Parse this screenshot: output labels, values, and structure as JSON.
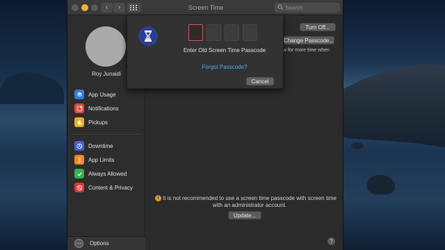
{
  "window": {
    "title": "Screen Time"
  },
  "search": {
    "placeholder": "Search"
  },
  "sidebar": {
    "user_name": "Roy Junaidi",
    "group1": [
      {
        "label": "App Usage",
        "icon": "layers-icon",
        "color": "#2f7de0"
      },
      {
        "label": "Notifications",
        "icon": "notifications-icon",
        "color": "#e04a3a"
      },
      {
        "label": "Pickups",
        "icon": "pickups-icon",
        "color": "#e8b21c"
      }
    ],
    "group2": [
      {
        "label": "Downtime",
        "icon": "downtime-icon",
        "color": "#4a5fd0"
      },
      {
        "label": "App Limits",
        "icon": "app-limits-icon",
        "color": "#f08a24"
      },
      {
        "label": "Always Allowed",
        "icon": "checkmark-icon",
        "color": "#37b24d"
      },
      {
        "label": "Content & Privacy",
        "icon": "restriction-icon",
        "color": "#e03535"
      }
    ],
    "options_label": "Options"
  },
  "main": {
    "turn_off_label": "Turn Off...",
    "change_passcode_label": "Change Passcode...",
    "more_time_text": "w for more time when",
    "warning_text": "It is not recommended to use a screen time passcode with screen time with an administrator account.",
    "update_label": "Update...",
    "help_label": "?"
  },
  "sheet": {
    "title": "Enter Old Screen Time Passcode",
    "forgot_label": "Forgot Passcode?",
    "cancel_label": "Cancel"
  },
  "colors": {
    "accent_link": "#5ba5f5",
    "warning": "#e39b2d",
    "passcode_active_border": "#d15a5a"
  }
}
